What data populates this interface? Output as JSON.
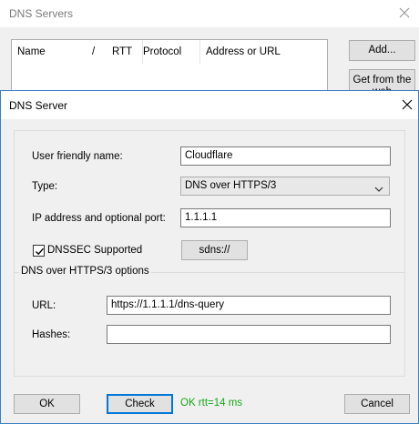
{
  "colors": {
    "accent": "#0078d7",
    "success": "#18a818"
  },
  "background_window": {
    "title": "DNS Servers",
    "columns": [
      {
        "label": "Name"
      },
      {
        "label": "/"
      },
      {
        "label": "RTT"
      },
      {
        "label": "Protocol"
      },
      {
        "label": "Address or URL"
      }
    ],
    "add_button": "Add...",
    "get_from_web_button": "Get from the web"
  },
  "dialog": {
    "title": "DNS Server",
    "fields": {
      "friendly_name_label": "User friendly name:",
      "friendly_name_value": "Cloudflare",
      "type_label": "Type:",
      "type_value": "DNS over HTTPS/3",
      "ip_label": "IP address and optional port:",
      "ip_value": "1.1.1.1",
      "dnssec_label": "DNSSEC Supported",
      "dnssec_checked": true,
      "sdns_button": "sdns://"
    },
    "group": {
      "title": "DNS over HTTPS/3 options",
      "url_label": "URL:",
      "url_value": "https://1.1.1.1/dns-query",
      "hashes_label": "Hashes:",
      "hashes_value": ""
    },
    "footer": {
      "ok_button": "OK",
      "check_button": "Check",
      "status_text": "OK rtt=14 ms",
      "cancel_button": "Cancel"
    }
  }
}
